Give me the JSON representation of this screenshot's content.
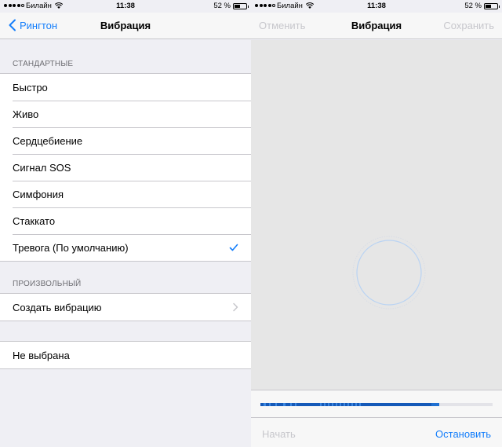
{
  "left_screen": {
    "status_bar": {
      "carrier": "Билайн",
      "time": "11:38",
      "battery_pct": "52 %",
      "battery_level": 0.52
    },
    "nav": {
      "back_label": "Рингтон",
      "title": "Вибрация"
    },
    "standard": {
      "header": "СТАНДАРТНЫЕ",
      "items": [
        {
          "label": "Быстро"
        },
        {
          "label": "Живо"
        },
        {
          "label": "Сердцебиение"
        },
        {
          "label": "Сигнал SOS"
        },
        {
          "label": "Симфония"
        },
        {
          "label": "Стаккато"
        },
        {
          "label": "Тревога (По умолчанию)",
          "selected": true
        }
      ]
    },
    "custom": {
      "header": "ПРОИЗВОЛЬНЫЙ",
      "create_label": "Создать вибрацию"
    },
    "none": {
      "label": "Не выбрана"
    }
  },
  "right_screen": {
    "status_bar": {
      "carrier": "Билайн",
      "time": "11:38",
      "battery_pct": "52 %",
      "battery_level": 0.52
    },
    "nav": {
      "cancel_label": "Отменить",
      "title": "Вибрация",
      "save_label": "Сохранить"
    },
    "recording": {
      "progress": 0.77
    },
    "buttons": {
      "start_label": "Начать",
      "stop_label": "Остановить"
    }
  },
  "colors": {
    "accent": "#147efb",
    "disabled": "#c7c7cc",
    "progress": "#1e6fd1",
    "background": "#efeff4"
  }
}
